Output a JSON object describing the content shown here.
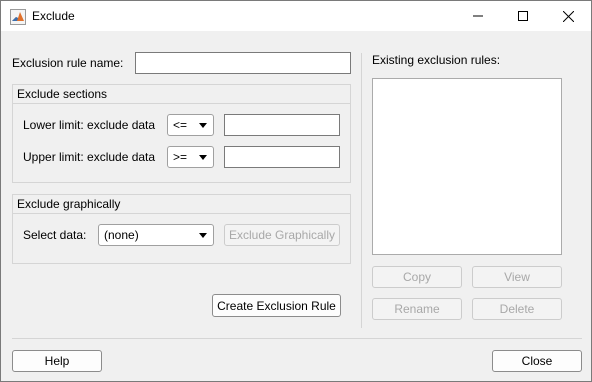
{
  "window": {
    "title": "Exclude",
    "icon": "matlab-membrane-icon",
    "controls": [
      "minimize-icon",
      "maximize-icon",
      "close-icon"
    ]
  },
  "rule_name": {
    "label": "Exclusion rule name:",
    "value": ""
  },
  "exclude_sections": {
    "title": "Exclude sections",
    "lower": {
      "label": "Lower limit: exclude data",
      "operator": "<=",
      "value": ""
    },
    "upper": {
      "label": "Upper limit: exclude data",
      "operator": ">=",
      "value": ""
    }
  },
  "exclude_graphically": {
    "title": "Exclude graphically",
    "select_label": "Select data:",
    "select_value": "(none)",
    "button_label": "Exclude Graphically"
  },
  "create_button_label": "Create Exclusion Rule",
  "existing_rules": {
    "label": "Existing exclusion rules:",
    "items": [],
    "copy_label": "Copy",
    "view_label": "View",
    "rename_label": "Rename",
    "delete_label": "Delete"
  },
  "footer": {
    "help_label": "Help",
    "close_label": "Close"
  }
}
